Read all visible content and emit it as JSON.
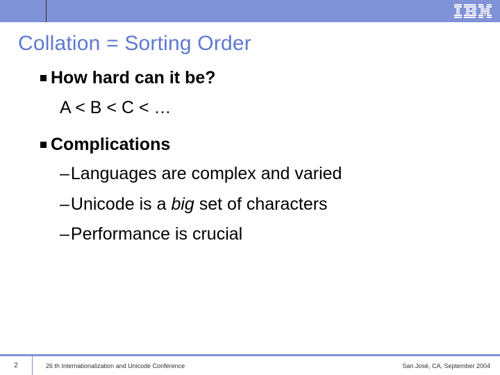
{
  "header": {
    "logo_name": "ibm-logo"
  },
  "title": "Collation = Sorting Order",
  "bullets": {
    "b1": "How hard can it be?",
    "b1_sub": "A < B < C < …",
    "b2": "Complications",
    "b2_items": {
      "i0": "Languages are complex and varied",
      "i1_pre": "Unicode is a ",
      "i1_em": "big",
      "i1_post": " set of characters",
      "i2": "Performance is crucial"
    }
  },
  "footer": {
    "page": "2",
    "conference": "26 th Internationalization and Unicode Conference",
    "location": "San José, CA, September 2004"
  }
}
